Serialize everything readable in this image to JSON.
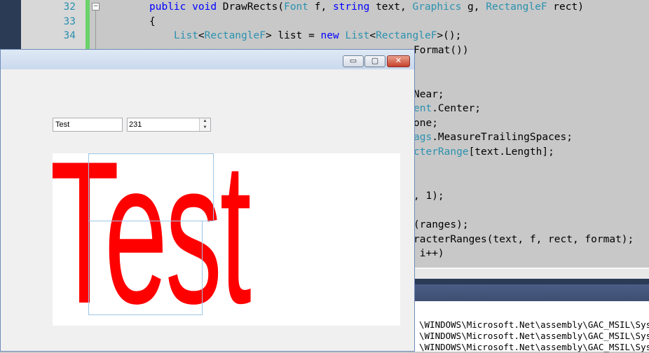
{
  "editor": {
    "lines": [
      {
        "num": "32"
      },
      {
        "num": "33"
      },
      {
        "num": "34"
      }
    ],
    "code": {
      "l32": [
        "public",
        "void",
        "DrawRects(",
        "Font",
        "f, ",
        "string",
        "text, ",
        "Graphics",
        "g, ",
        "RectangleF",
        "rect)"
      ],
      "l33": "{",
      "l34": [
        "List",
        "<",
        "RectangleF",
        "> list = ",
        "new",
        "List",
        "<",
        "RectangleF",
        ">();"
      ],
      "l35_tail": "Format())",
      "right_fragments": [
        "Near;",
        "ent.Center;",
        "one;",
        "ags.MeasureTrailingSpaces;",
        "cterRange[text.Length];",
        ", 1);",
        "(ranges);",
        "racterRanges(text, f, rect, format);",
        " i++)"
      ]
    }
  },
  "output": {
    "lines": [
      "\\WINDOWS\\Microsoft.Net\\assembly\\GAC_MSIL\\System",
      "\\WINDOWS\\Microsoft.Net\\assembly\\GAC_MSIL\\System",
      "\\WINDOWS\\Microsoft.Net\\assembly\\GAC_MSIL\\System"
    ]
  },
  "window": {
    "caption_buttons": {
      "minimize": "▭",
      "maximize": "▢",
      "close": "✕"
    },
    "text_field": {
      "value": "Test"
    },
    "numeric_field": {
      "value": "231"
    },
    "rendered_text": "Test"
  }
}
